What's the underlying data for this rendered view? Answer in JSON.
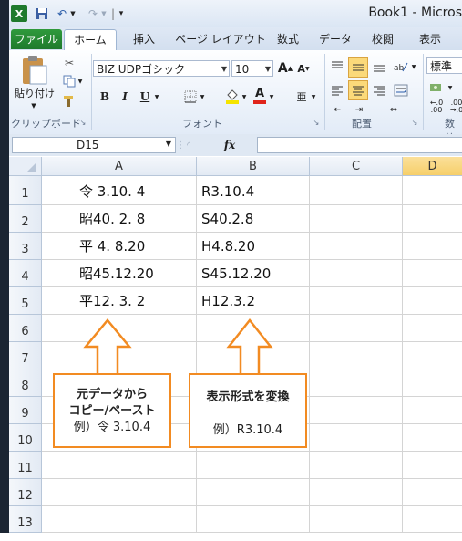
{
  "window": {
    "title": "Book1 - Micros"
  },
  "tabs": [
    {
      "label": "ファイル"
    },
    {
      "label": "ホーム"
    },
    {
      "label": "挿入"
    },
    {
      "label": "ページ レイアウト"
    },
    {
      "label": "数式"
    },
    {
      "label": "データ"
    },
    {
      "label": "校閲"
    },
    {
      "label": "表示"
    }
  ],
  "ribbon": {
    "clipboard": {
      "paste_label": "貼り付け",
      "group_label": "クリップボード"
    },
    "font": {
      "font_name": "BIZ UDPゴシック",
      "font_size": "10",
      "group_label": "フォント",
      "bold": "B",
      "italic": "I",
      "underline": "U"
    },
    "alignment": {
      "group_label": "配置"
    },
    "number": {
      "format": "標準",
      "group_label": "数値"
    }
  },
  "formula_bar": {
    "name_box": "D15",
    "fx": "fx",
    "formula": ""
  },
  "columns": [
    "A",
    "B",
    "C",
    "D"
  ],
  "rows": [
    "1",
    "2",
    "3",
    "4",
    "5",
    "6",
    "7",
    "8",
    "9",
    "10",
    "11",
    "12",
    "13"
  ],
  "cells": [
    {
      "a": "令 3.10. 4",
      "b": "R3.10.4"
    },
    {
      "a": "昭40. 2. 8",
      "b": "S40.2.8"
    },
    {
      "a": "平 4. 8.20",
      "b": "H4.8.20"
    },
    {
      "a": "昭45.12.20",
      "b": "S45.12.20"
    },
    {
      "a": "平12. 3. 2",
      "b": "H12.3.2"
    }
  ],
  "callouts": {
    "left": {
      "line1": "元データから",
      "line2": "コピー/ペースト",
      "line3": "例）令 3.10.4"
    },
    "right": {
      "line1": "表示形式を変換",
      "line2": "例）R3.10.4"
    }
  },
  "colors": {
    "accent_orange": "#f28b22",
    "excel_green": "#1f7a2d",
    "selected_col_header": "#f6cf6a"
  }
}
